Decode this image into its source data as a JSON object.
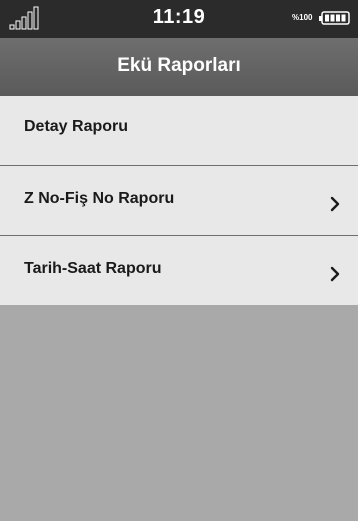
{
  "status_bar": {
    "time": "11:19",
    "battery_percent": "%100",
    "signal_icon": "signal-bars-icon",
    "battery_icon": "battery-full-icon"
  },
  "header": {
    "title": "Ekü Raporları"
  },
  "menu": {
    "items": [
      {
        "label": "Detay Raporu",
        "has_chevron": false
      },
      {
        "label": "Z No-Fiş No Raporu",
        "has_chevron": true,
        "icon": "chevron-right-icon"
      },
      {
        "label": "Tarih-Saat Raporu",
        "has_chevron": true,
        "icon": "chevron-right-icon"
      }
    ]
  },
  "colors": {
    "status_bar_bg": "#2b2b2b",
    "title_bar_bg": "#626262",
    "list_item_bg": "#e8e8e8",
    "empty_bg": "#a9a9a9",
    "divider": "#6f6f6f"
  }
}
